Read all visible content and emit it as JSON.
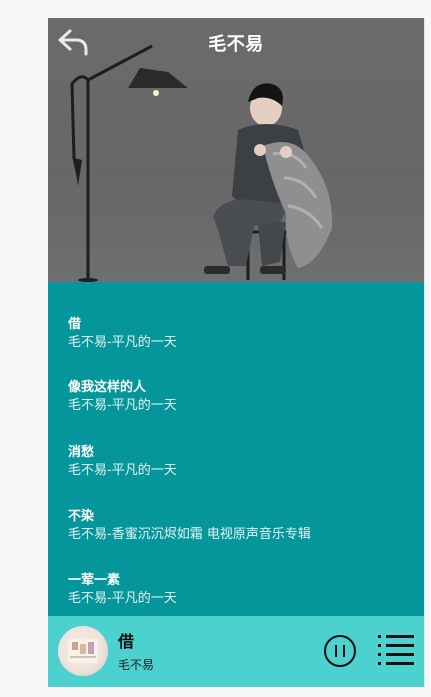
{
  "header": {
    "title": "毛不易",
    "back_icon": "back-arrow-icon"
  },
  "songs": [
    {
      "name": "借",
      "meta": "毛不易-平凡的一天"
    },
    {
      "name": "像我这样的人",
      "meta": "毛不易-平凡的一天"
    },
    {
      "name": "消愁",
      "meta": "毛不易-平凡的一天"
    },
    {
      "name": "不染",
      "meta": "毛不易-香蜜沉沉烬如霜 电视原声音乐专辑"
    },
    {
      "name": "一荤一素",
      "meta": "毛不易-平凡的一天"
    }
  ],
  "player": {
    "title": "借",
    "artist": "毛不易",
    "pause_icon": "pause-icon",
    "playlist_icon": "playlist-icon"
  },
  "colors": {
    "list_bg": "#05969b",
    "player_bg": "#4dd1cf",
    "hero_bg": "#6b6b6b"
  }
}
